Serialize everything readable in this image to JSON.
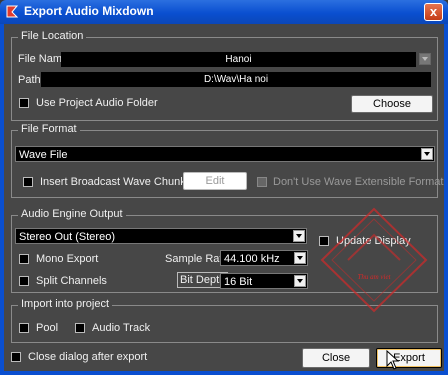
{
  "window": {
    "title": "Export Audio Mixdown",
    "close_glyph": "x"
  },
  "file_location": {
    "group_label": "File Location",
    "file_name_label": "File Name",
    "file_name_value": "Hanoi",
    "path_label": "Path",
    "path_value": "D:\\Wav\\Ha noi",
    "use_project_folder_label": "Use Project Audio Folder",
    "choose_label": "Choose"
  },
  "file_format": {
    "group_label": "File Format",
    "format_value": "Wave File",
    "insert_bwc_label": "Insert Broadcast Wave Chunk",
    "edit_label": "Edit",
    "dont_use_wef_label": "Don't Use Wave Extensible Format"
  },
  "audio_engine": {
    "group_label": "Audio Engine Output",
    "output_value": "Stereo Out (Stereo)",
    "update_display_label": "Update Display",
    "mono_export_label": "Mono Export",
    "sample_rate_label": "Sample Rate",
    "sample_rate_value": "44.100 kHz",
    "split_channels_label": "Split Channels",
    "bit_depth_label": "Bit Depth",
    "bit_depth_value": "16 Bit"
  },
  "import": {
    "group_label": "Import into project",
    "pool_label": "Pool",
    "audio_track_label": "Audio Track"
  },
  "footer": {
    "close_after_export_label": "Close dialog after export",
    "close_label": "Close",
    "export_label": "Export"
  },
  "watermark_text": "Thu am viet",
  "colors": {
    "titlebar": "#0a4fd0",
    "panel": "#474747",
    "field": "#000000",
    "accent_red": "#d22a2a"
  }
}
